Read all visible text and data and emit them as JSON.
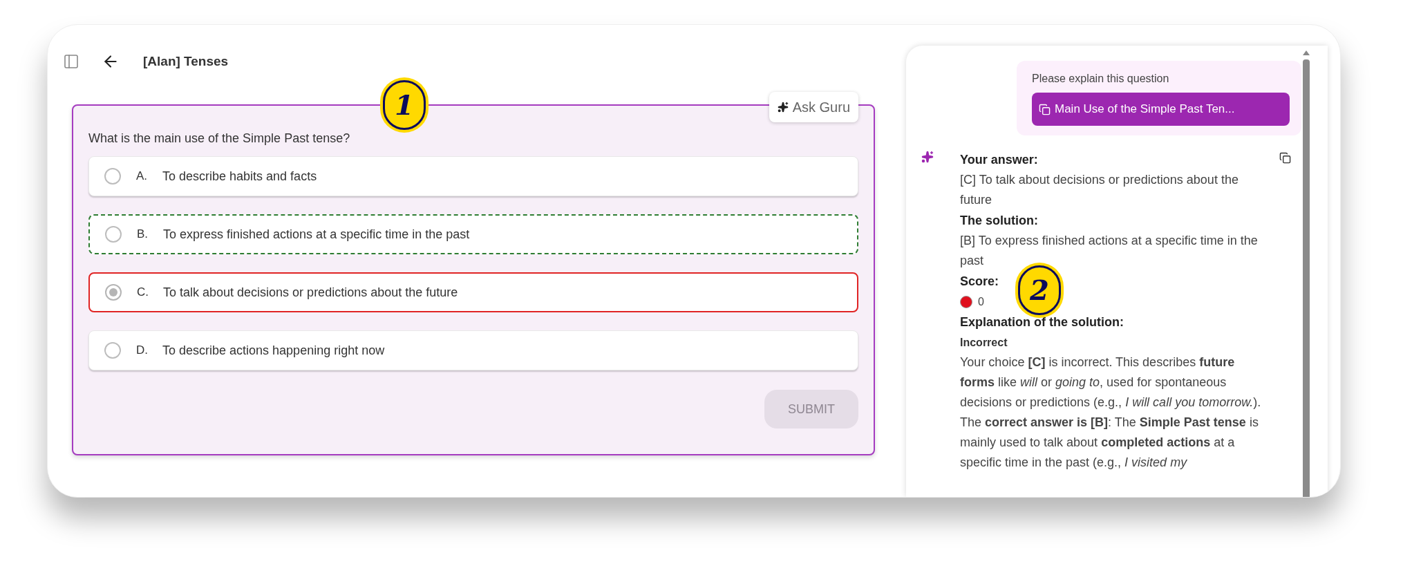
{
  "header": {
    "title": "[Alan] Tenses"
  },
  "quiz": {
    "question": "What is the main use of the Simple Past tense?",
    "ask_button": "Ask Guru",
    "options": [
      {
        "letter": "A.",
        "text": "To describe habits and facts",
        "selected": false,
        "kind": "plain"
      },
      {
        "letter": "B.",
        "text": "To express finished actions at a specific time in the past",
        "selected": false,
        "kind": "correct"
      },
      {
        "letter": "C.",
        "text": "To talk about decisions or predictions about the future",
        "selected": true,
        "kind": "incorrect"
      },
      {
        "letter": "D.",
        "text": "To describe actions happening right now",
        "selected": false,
        "kind": "plain"
      }
    ],
    "submit": {
      "label": "SUBMIT",
      "disabled": true
    }
  },
  "annotations": [
    {
      "label": "1"
    },
    {
      "label": "2"
    }
  ],
  "chat": {
    "request": {
      "text": "Please explain this question",
      "chip": "Main Use of the Simple Past Ten..."
    },
    "response": {
      "your_answer_heading": "Your answer:",
      "your_answer": "[C] To talk about decisions or predictions about the future",
      "solution_heading": "The solution:",
      "solution": "[B] To express finished actions at a specific time in the past",
      "score_heading": "Score:",
      "score": {
        "value": "0",
        "passed": false
      },
      "explanation_heading": "Explanation of the solution:",
      "verdict": "Incorrect",
      "paragraphs": [
        "Your choice **[C]** is incorrect. This describes **future forms** like *will* or *going to*, used for spontaneous decisions or predictions (e.g., *I will call you tomorrow.*).",
        "The **correct answer is [B]**: The **Simple Past tense** is mainly used to talk about **completed actions** at a specific time in the past (e.g., *I visited my*"
      ]
    }
  }
}
